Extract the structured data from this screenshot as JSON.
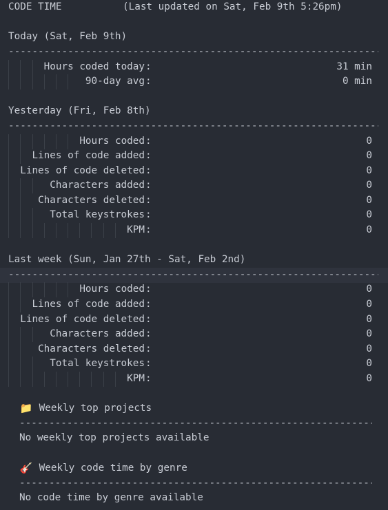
{
  "header": {
    "title": "CODE TIME",
    "updated": "(Last updated on Sat, Feb 9th 5:26pm)"
  },
  "today": {
    "heading": "Today (Sat, Feb 9th)",
    "rows": [
      {
        "label": "Hours coded today",
        "value": "31 min"
      },
      {
        "label": "90-day avg",
        "value": "0 min"
      }
    ]
  },
  "yesterday": {
    "heading": "Yesterday (Fri, Feb 8th)",
    "rows": [
      {
        "label": "Hours coded",
        "value": "0"
      },
      {
        "label": "Lines of code added",
        "value": "0"
      },
      {
        "label": "Lines of code deleted",
        "value": "0"
      },
      {
        "label": "Characters added",
        "value": "0"
      },
      {
        "label": "Characters deleted",
        "value": "0"
      },
      {
        "label": "Total keystrokes",
        "value": "0"
      },
      {
        "label": "KPM",
        "value": "0"
      }
    ]
  },
  "last_week": {
    "heading": "Last week (Sun, Jan 27th - Sat, Feb 2nd)",
    "rows": [
      {
        "label": "Hours coded",
        "value": "0"
      },
      {
        "label": "Lines of code added",
        "value": "0"
      },
      {
        "label": "Lines of code deleted",
        "value": "0"
      },
      {
        "label": "Characters added",
        "value": "0"
      },
      {
        "label": "Characters deleted",
        "value": "0"
      },
      {
        "label": "Total keystrokes",
        "value": "0"
      },
      {
        "label": "KPM",
        "value": "0"
      }
    ]
  },
  "colon": ":",
  "rule": "-----------------------------------------------------------------------------",
  "top_projects": {
    "icon": "📁",
    "icon_name": "folder-icon",
    "heading": "Weekly top projects",
    "empty_text": "No weekly top projects available"
  },
  "genre": {
    "icon": "🎸",
    "icon_name": "guitar-icon",
    "heading": "Weekly code time by genre",
    "empty_text": "No code time by genre available"
  }
}
